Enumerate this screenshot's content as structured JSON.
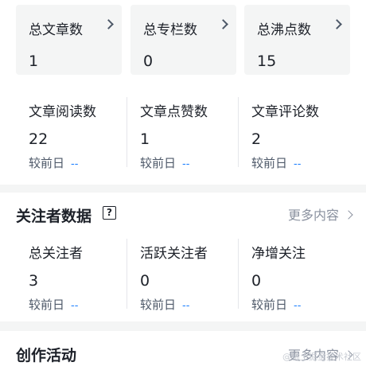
{
  "top_stats": [
    {
      "label": "总文章数",
      "value": "1"
    },
    {
      "label": "总专栏数",
      "value": "0"
    },
    {
      "label": "总沸点数",
      "value": "15"
    }
  ],
  "article_metrics": [
    {
      "label": "文章阅读数",
      "value": "22",
      "compare_label": "较前日",
      "compare_value": "--"
    },
    {
      "label": "文章点赞数",
      "value": "1",
      "compare_label": "较前日",
      "compare_value": "--"
    },
    {
      "label": "文章评论数",
      "value": "2",
      "compare_label": "较前日",
      "compare_value": "--"
    }
  ],
  "follower_section": {
    "title": "关注者数据",
    "help_icon": "help-icon",
    "more_label": "更多内容",
    "metrics": [
      {
        "label": "总关注者",
        "value": "3",
        "compare_label": "较前日",
        "compare_value": "--"
      },
      {
        "label": "活跃关注者",
        "value": "0",
        "compare_label": "较前日",
        "compare_value": "--"
      },
      {
        "label": "净增关注",
        "value": "0",
        "compare_label": "较前日",
        "compare_value": "--"
      }
    ]
  },
  "creation_section": {
    "title": "创作活动",
    "more_label": "更多内容"
  },
  "watermark": "@稀土掘金技术社区",
  "colors": {
    "background": "#f4f5f5",
    "card": "#ffffff",
    "text_primary": "#1d2129",
    "text_secondary": "#4e5969",
    "text_muted": "#8a919f",
    "accent": "#1e80ff"
  }
}
